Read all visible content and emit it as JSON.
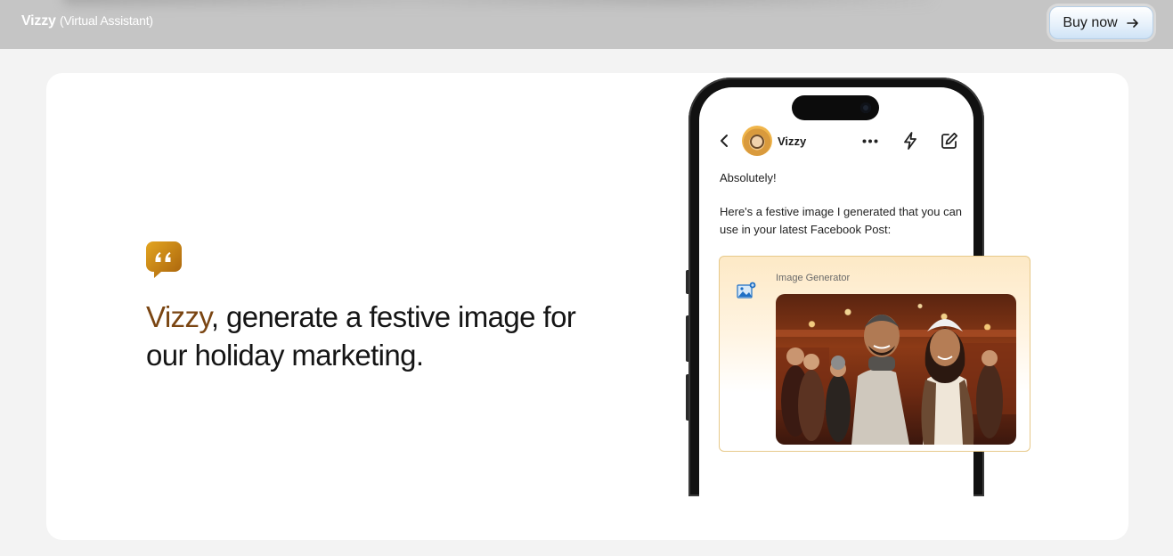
{
  "topbar": {
    "brand_name": "Vizzy",
    "brand_sub": "(Virtual Assistant)",
    "buy_label": "Buy now",
    "buy_icon": "arrow-right-icon"
  },
  "hero": {
    "quote_icon": "quote-bubble-icon",
    "headline_name": "Vizzy",
    "headline_rest": ", generate a festive image for our holiday marketing."
  },
  "phone": {
    "chat_name": "Vizzy",
    "icons": [
      "back-chevron-icon",
      "avatar",
      "more-dots-icon",
      "bolt-icon",
      "edit-icon"
    ],
    "message_1": "Absolutely!",
    "message_2": "Here's a festive image I generated that you can use in your latest Facebook Post:",
    "generator_label": "Image Generator",
    "generator_icon": "image-generator-icon"
  },
  "colors": {
    "topbar": "#c5c5c5",
    "accent_brown": "#7a4512",
    "quote_gold": "#c78a12",
    "card_bg": "#ffffff",
    "page_bg": "#f3f3f3"
  }
}
